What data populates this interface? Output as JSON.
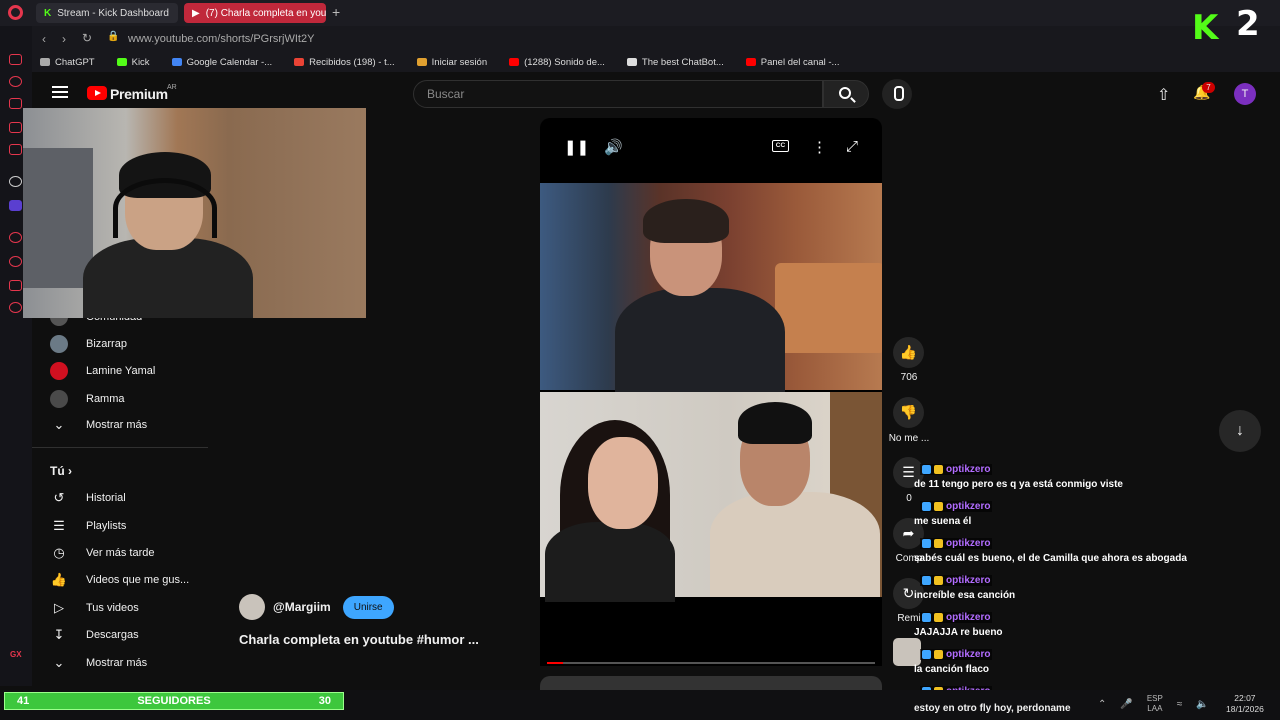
{
  "browser": {
    "tabs": [
      {
        "label": "Stream - Kick Dashboard"
      },
      {
        "label": "(7) Charla completa en youtube"
      }
    ],
    "url": "www.youtube.com/shorts/PGrsrjWIt2Y",
    "bookmarks": [
      "ChatGPT",
      "Kick",
      "Google Calendar -...",
      "Recibidos (198) - t...",
      "Iniciar sesión",
      "(1288) Sonido de...",
      "The best ChatBot...",
      "Panel del canal -..."
    ]
  },
  "youtube": {
    "brand": "Premium",
    "region": "AR",
    "search_placeholder": "Buscar",
    "notif_count": "7",
    "avatar_letter": "T",
    "subscriptions": [
      {
        "label": "Comunidad"
      },
      {
        "label": "Bizarrap"
      },
      {
        "label": "Lamine Yamal"
      },
      {
        "label": "Ramma"
      },
      {
        "label": "Mostrar más"
      }
    ],
    "you_section": "Tú",
    "you_items": [
      {
        "label": "Historial"
      },
      {
        "label": "Playlists"
      },
      {
        "label": "Ver más tarde"
      },
      {
        "label": "Videos que me gus..."
      },
      {
        "label": "Tus videos"
      },
      {
        "label": "Descargas"
      },
      {
        "label": "Mostrar más"
      }
    ],
    "short": {
      "channel": "@Margiim",
      "join_label": "Unirse",
      "title": "Charla completa en youtube #humor ...",
      "likes": "706",
      "dislike_label": "No me ...",
      "comments": "0",
      "share_label": "Comp",
      "remix_label": "Remi",
      "cc_label": "CC"
    }
  },
  "chat": {
    "messages": [
      {
        "user": "optikzero",
        "text": "de 11 tengo pero es q ya está conmigo viste"
      },
      {
        "user": "optikzero",
        "text": "me suena él"
      },
      {
        "user": "optikzero",
        "text": "sabés cuál es bueno, el de Camilla que ahora es abogada"
      },
      {
        "user": "optikzero",
        "text": "increíble esa canción"
      },
      {
        "user": "optikzero",
        "text": "JAJAJJA re bueno"
      },
      {
        "user": "optikzero",
        "text": "la canción flaco"
      },
      {
        "user": "optikzero",
        "text": "estoy en otro fly hoy, perdoname"
      }
    ]
  },
  "overlay": {
    "logo_text": "2",
    "followers_label": "SEGUIDORES",
    "followers_current": "41",
    "followers_goal": "30"
  },
  "taskbar": {
    "lang1": "ESP",
    "lang2": "LAA",
    "time": "22:07",
    "date": "18/1/2026"
  },
  "colors": {
    "accent": "#ff0000",
    "kick": "#53fc18",
    "chat_user": "#b26cff",
    "join": "#3ea6ff"
  }
}
